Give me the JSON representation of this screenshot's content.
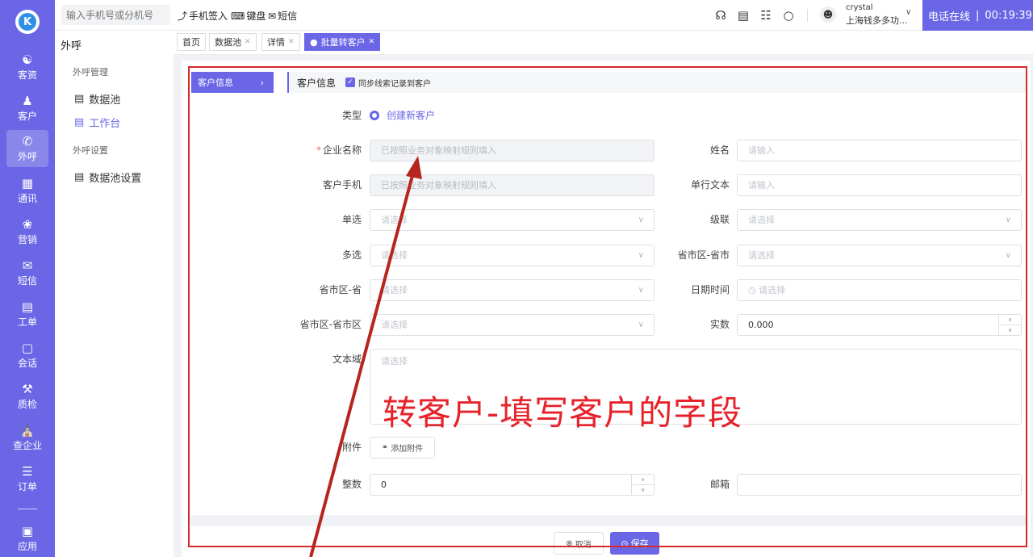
{
  "left_nav": {
    "logo_letter": "K",
    "items": [
      {
        "label": "客资",
        "icon": "customer-leads-icon"
      },
      {
        "label": "客户",
        "icon": "customer-icon"
      },
      {
        "label": "外呼",
        "icon": "outbound-call-icon",
        "active": true
      },
      {
        "label": "通讯",
        "icon": "contacts-icon"
      },
      {
        "label": "营销",
        "icon": "marketing-icon"
      },
      {
        "label": "短信",
        "icon": "sms-icon"
      },
      {
        "label": "工单",
        "icon": "ticket-icon"
      },
      {
        "label": "会话",
        "icon": "chat-icon"
      },
      {
        "label": "质检",
        "icon": "quality-check-icon"
      },
      {
        "label": "查企业",
        "icon": "company-search-icon"
      },
      {
        "label": "订单",
        "icon": "order-icon"
      },
      {
        "label": "应用",
        "icon": "app-icon"
      }
    ]
  },
  "topbar": {
    "search_placeholder": "输入手机号或分机号",
    "phone_signin": "手机签入",
    "keyboard": "键盘",
    "sms": "短信",
    "user_name": "crystal",
    "user_org": "上海钱多多功...",
    "status_label": "电话在线",
    "timer": "00:19:39"
  },
  "sub_nav": {
    "title": "外呼",
    "group1": "外呼管理",
    "link_data_pool": "数据池",
    "link_workbench": "工作台",
    "group2": "外呼设置",
    "link_pool_settings": "数据池设置"
  },
  "tabs": {
    "home": "首页",
    "data_pool": "数据池",
    "detail": "详情",
    "batch_convert": "批量转客户"
  },
  "section": {
    "side_tab": "客户信息",
    "title": "客户信息",
    "sync_checkbox": "同步线索记录到客户"
  },
  "form": {
    "type_label": "类型",
    "type_value": "创建新客户",
    "company_label": "企业名称",
    "company_placeholder": "已按照业务对象映射规则填入",
    "name_label": "姓名",
    "name_placeholder": "请输入",
    "phone_label": "客户手机",
    "phone_placeholder": "已按照业务对象映射规则填入",
    "single_text_label": "单行文本",
    "single_text_placeholder": "请输入",
    "single_select_label": "单选",
    "single_select_placeholder": "请选择",
    "cascade_label": "级联",
    "cascade_placeholder": "请选择",
    "multi_select_label": "多选",
    "multi_select_placeholder": "请选择",
    "province_city_label": "省市区-省市",
    "province_city_placeholder": "请选择",
    "province_label": "省市区-省",
    "province_placeholder": "请选择",
    "datetime_label": "日期时间",
    "datetime_placeholder": "请选择",
    "province_city_district_label": "省市区-省市区",
    "province_city_district_placeholder": "请选择",
    "real_number_label": "实数",
    "real_number_value": "0.000",
    "textarea_label": "文本域",
    "textarea_placeholder": "请选择",
    "attachment_label": "附件",
    "attachment_button": "添加附件",
    "integer_label": "整数",
    "integer_value": "0",
    "email_label": "邮箱"
  },
  "footer": {
    "cancel": "取消",
    "save": "保存"
  },
  "annotation": {
    "text": "转客户-填写客户的字段",
    "color": "#e6222a"
  },
  "colors": {
    "accent": "#6a66e6",
    "required": "#f56c6c"
  }
}
